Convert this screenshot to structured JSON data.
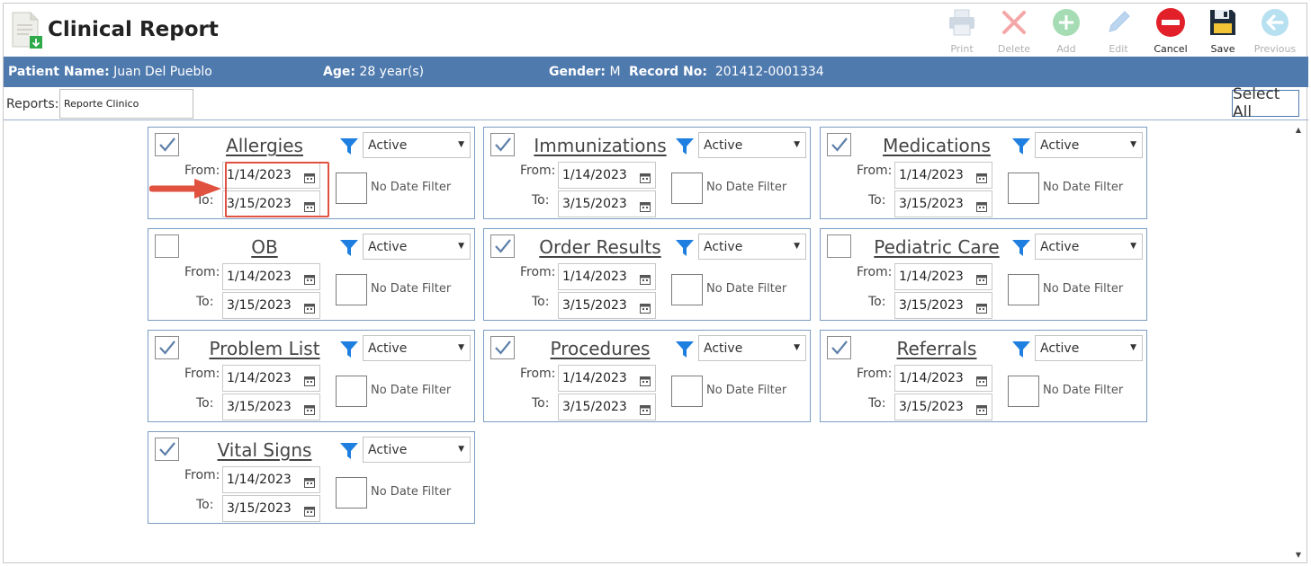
{
  "header": {
    "title": "Clinical Report",
    "toolbar": [
      {
        "label": "Print",
        "icon": "print-icon",
        "enabled": false
      },
      {
        "label": "Delete",
        "icon": "delete-icon",
        "enabled": false
      },
      {
        "label": "Add",
        "icon": "add-icon",
        "enabled": false
      },
      {
        "label": "Edit",
        "icon": "edit-icon",
        "enabled": false
      },
      {
        "label": "Cancel",
        "icon": "cancel-icon",
        "enabled": true
      },
      {
        "label": "Save",
        "icon": "save-icon",
        "enabled": true
      },
      {
        "label": "Previous",
        "icon": "previous-icon",
        "enabled": false
      }
    ]
  },
  "patient": {
    "name_label": "Patient Name:",
    "name": "Juan Del Pueblo",
    "age_label": "Age:",
    "age": "28 year(s)",
    "gender_label": "Gender:",
    "gender": "M",
    "record_label": "Record No:",
    "record": "201412-0001334"
  },
  "reports": {
    "label": "Reports:",
    "value": "Reporte Clinico",
    "select_all": "Select All"
  },
  "labels": {
    "from": "From:",
    "to": "To:",
    "no_date_filter": "No Date Filter"
  },
  "sections": [
    {
      "title": "Allergies",
      "checked": true,
      "status": "Active",
      "from": "1/14/2023",
      "to": "3/15/2023"
    },
    {
      "title": "Immunizations",
      "checked": true,
      "status": "Active",
      "from": "1/14/2023",
      "to": "3/15/2023"
    },
    {
      "title": "Medications",
      "checked": true,
      "status": "Active",
      "from": "1/14/2023",
      "to": "3/15/2023"
    },
    {
      "title": "OB",
      "checked": false,
      "status": "Active",
      "from": "1/14/2023",
      "to": "3/15/2023"
    },
    {
      "title": "Order Results",
      "checked": true,
      "status": "Active",
      "from": "1/14/2023",
      "to": "3/15/2023"
    },
    {
      "title": "Pediatric Care",
      "checked": false,
      "status": "Active",
      "from": "1/14/2023",
      "to": "3/15/2023"
    },
    {
      "title": "Problem List",
      "checked": true,
      "status": "Active",
      "from": "1/14/2023",
      "to": "3/15/2023"
    },
    {
      "title": "Procedures",
      "checked": true,
      "status": "Active",
      "from": "1/14/2023",
      "to": "3/15/2023"
    },
    {
      "title": "Referrals",
      "checked": true,
      "status": "Active",
      "from": "1/14/2023",
      "to": "3/15/2023"
    },
    {
      "title": "Vital Signs",
      "checked": true,
      "status": "Active",
      "from": "1/14/2023",
      "to": "3/15/2023"
    }
  ],
  "colors": {
    "accent": "#4f7aae",
    "highlight": "#e0523f",
    "filter_icon": "#1e7fe0"
  }
}
